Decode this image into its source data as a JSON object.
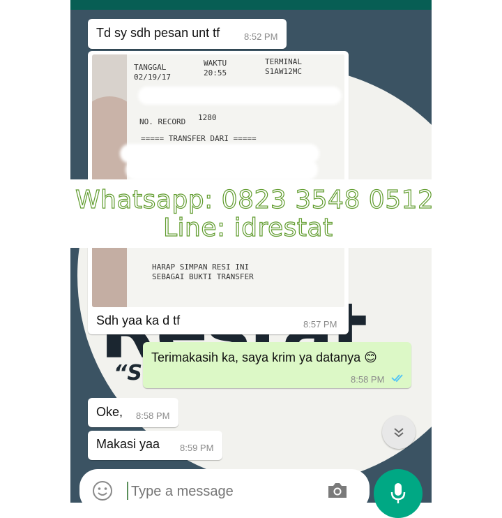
{
  "watermark": {
    "whatsapp": "Whatsapp: 0823 3548 0512",
    "line": "Line: idrestat"
  },
  "background": {
    "brand_text": "Restat",
    "slogan_fragment": "“St"
  },
  "messages": [
    {
      "direction": "in",
      "text": "Td sy sdh pesan unt tf",
      "time": "8:52 PM"
    },
    {
      "direction": "in",
      "text": "Sdh yaa ka d tf",
      "time": "8:57 PM",
      "has_image": true
    },
    {
      "direction": "out",
      "text": "Terimakasih ka, saya krim ya datanya 😊",
      "time": "8:58 PM",
      "status": "read"
    },
    {
      "direction": "in",
      "text": "Oke,",
      "time": "8:58 PM"
    },
    {
      "direction": "in",
      "text": "Makasi yaa",
      "time": "8:59 PM"
    }
  ],
  "receipt": {
    "tanggal_label": "TANGGAL",
    "tanggal_value": "02/19/17",
    "waktu_label": "WAKTU",
    "waktu_value": "20:55",
    "terminal_label": "TERMINAL",
    "terminal_value": "S1AW12MC",
    "record_label": "NO. RECORD",
    "record_value": "1280",
    "transfer_header": "===== TRANSFER DARI =====",
    "footer_line1": "HARAP SIMPAN RESI INI",
    "footer_line2": "SEBAGAI BUKTI TRANSFER"
  },
  "composer": {
    "placeholder": "Type a message"
  },
  "icons": {
    "emoji": "emoji-icon",
    "camera": "camera-icon",
    "mic": "mic-icon",
    "scroll_down": "chevron-double-down-icon",
    "read_ticks": "double-check-icon"
  },
  "colors": {
    "header": "#075e54",
    "outgoing_bubble": "#dcf8c6",
    "incoming_bubble": "#ffffff",
    "read_ticks": "#4fc3f7",
    "mic_button": "#00a884",
    "watermark_stroke": "#5f9b2c"
  }
}
